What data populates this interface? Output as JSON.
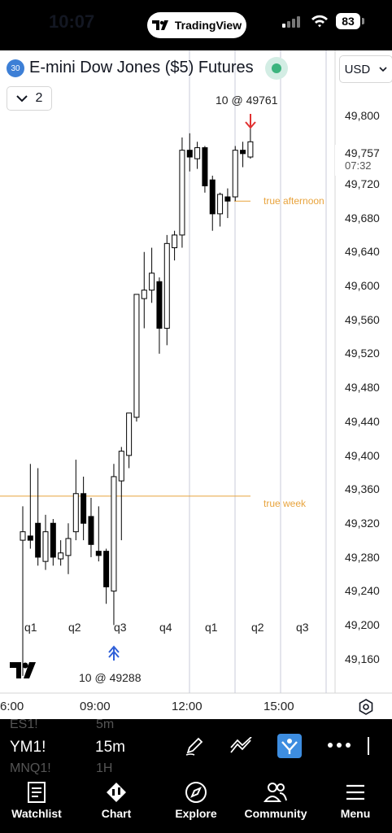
{
  "status_bar": {
    "time": "10:07",
    "app_pill": "TradingView",
    "battery": "83"
  },
  "header": {
    "interval_badge": "30",
    "symbol_title": "E-mini Dow Jones ($5) Futures",
    "indicators_count": "2",
    "currency": "USD"
  },
  "chart": {
    "annotations": {
      "top_trade": "10 @ 49761",
      "bottom_trade": "10 @ 49288",
      "true_afternoon": "true afternoon",
      "true_week": "true week",
      "last_price": "49,757",
      "countdown": "07:32"
    },
    "quarter_labels": [
      "q1",
      "q2",
      "q3",
      "q4",
      "q1",
      "q2",
      "q3"
    ],
    "price_ticks": [
      "49,800",
      "49,720",
      "49,680",
      "49,640",
      "49,600",
      "49,560",
      "49,520",
      "49,480",
      "49,440",
      "49,400",
      "49,360",
      "49,320",
      "49,280",
      "49,240",
      "49,200",
      "49,160"
    ],
    "time_ticks": [
      "6:00",
      "09:00",
      "12:00",
      "15:00"
    ],
    "colors": {
      "bull": "#ffffff",
      "bear": "#000000",
      "level_line": "#e8a33c",
      "buy_arrow": "#3060d8",
      "sell_arrow": "#e03030",
      "session_line": "#c8cbd8"
    }
  },
  "chart_data": {
    "type": "candlestick",
    "y_axis_range": [
      49140,
      49840
    ],
    "levels": [
      {
        "name": "true afternoon",
        "price": 49700
      },
      {
        "name": "true week",
        "price": 49352
      }
    ],
    "trades": [
      {
        "side": "sell",
        "qty": 10,
        "price": 49761
      },
      {
        "side": "buy",
        "qty": 10,
        "price": 49288
      }
    ],
    "candles": [
      {
        "o": 49300,
        "h": 49340,
        "l": 49140,
        "c": 49310
      },
      {
        "o": 49305,
        "h": 49390,
        "l": 49290,
        "c": 49300
      },
      {
        "o": 49320,
        "h": 49385,
        "l": 49270,
        "c": 49280
      },
      {
        "o": 49275,
        "h": 49330,
        "l": 49265,
        "c": 49310
      },
      {
        "o": 49320,
        "h": 49325,
        "l": 49270,
        "c": 49280
      },
      {
        "o": 49278,
        "h": 49300,
        "l": 49270,
        "c": 49285
      },
      {
        "o": 49282,
        "h": 49320,
        "l": 49260,
        "c": 49302
      },
      {
        "o": 49310,
        "h": 49395,
        "l": 49300,
        "c": 49355
      },
      {
        "o": 49355,
        "h": 49375,
        "l": 49300,
        "c": 49320
      },
      {
        "o": 49328,
        "h": 49350,
        "l": 49280,
        "c": 49295
      },
      {
        "o": 49287,
        "h": 49340,
        "l": 49275,
        "c": 49282
      },
      {
        "o": 49287,
        "h": 49290,
        "l": 49225,
        "c": 49245
      },
      {
        "o": 49240,
        "h": 49390,
        "l": 49200,
        "c": 49375
      },
      {
        "o": 49370,
        "h": 49410,
        "l": 49300,
        "c": 49405
      },
      {
        "o": 49400,
        "h": 49450,
        "l": 49385,
        "c": 49450
      },
      {
        "o": 49445,
        "h": 49590,
        "l": 49440,
        "c": 49590
      },
      {
        "o": 49585,
        "h": 49640,
        "l": 49550,
        "c": 49595
      },
      {
        "o": 49595,
        "h": 49645,
        "l": 49580,
        "c": 49615
      },
      {
        "o": 49605,
        "h": 49610,
        "l": 49520,
        "c": 49550
      },
      {
        "o": 49550,
        "h": 49660,
        "l": 49530,
        "c": 49650
      },
      {
        "o": 49645,
        "h": 49665,
        "l": 49630,
        "c": 49660
      },
      {
        "o": 49660,
        "h": 49775,
        "l": 49645,
        "c": 49760
      },
      {
        "o": 49760,
        "h": 49780,
        "l": 49735,
        "c": 49752
      },
      {
        "o": 49750,
        "h": 49770,
        "l": 49738,
        "c": 49763
      },
      {
        "o": 49763,
        "h": 49765,
        "l": 49710,
        "c": 49718
      },
      {
        "o": 49725,
        "h": 49730,
        "l": 49665,
        "c": 49685
      },
      {
        "o": 49685,
        "h": 49710,
        "l": 49670,
        "c": 49708
      },
      {
        "o": 49705,
        "h": 49715,
        "l": 49680,
        "c": 49700
      },
      {
        "o": 49705,
        "h": 49765,
        "l": 49700,
        "c": 49760
      },
      {
        "o": 49760,
        "h": 49770,
        "l": 49740,
        "c": 49756
      },
      {
        "o": 49752,
        "h": 49793,
        "l": 49750,
        "c": 49770
      }
    ]
  },
  "toolbar": {
    "symbol": "YM1!",
    "interval": "15m",
    "bg_symbol_above": "ES1!",
    "bg_interval_above": "5m",
    "bg_symbol_below": "MNQ1!",
    "bg_interval_below": "1H"
  },
  "tabs": [
    {
      "label": "Watchlist",
      "icon": "watchlist-icon"
    },
    {
      "label": "Chart",
      "icon": "chart-icon"
    },
    {
      "label": "Explore",
      "icon": "compass-icon"
    },
    {
      "label": "Community",
      "icon": "community-icon"
    },
    {
      "label": "Menu",
      "icon": "menu-icon"
    }
  ]
}
